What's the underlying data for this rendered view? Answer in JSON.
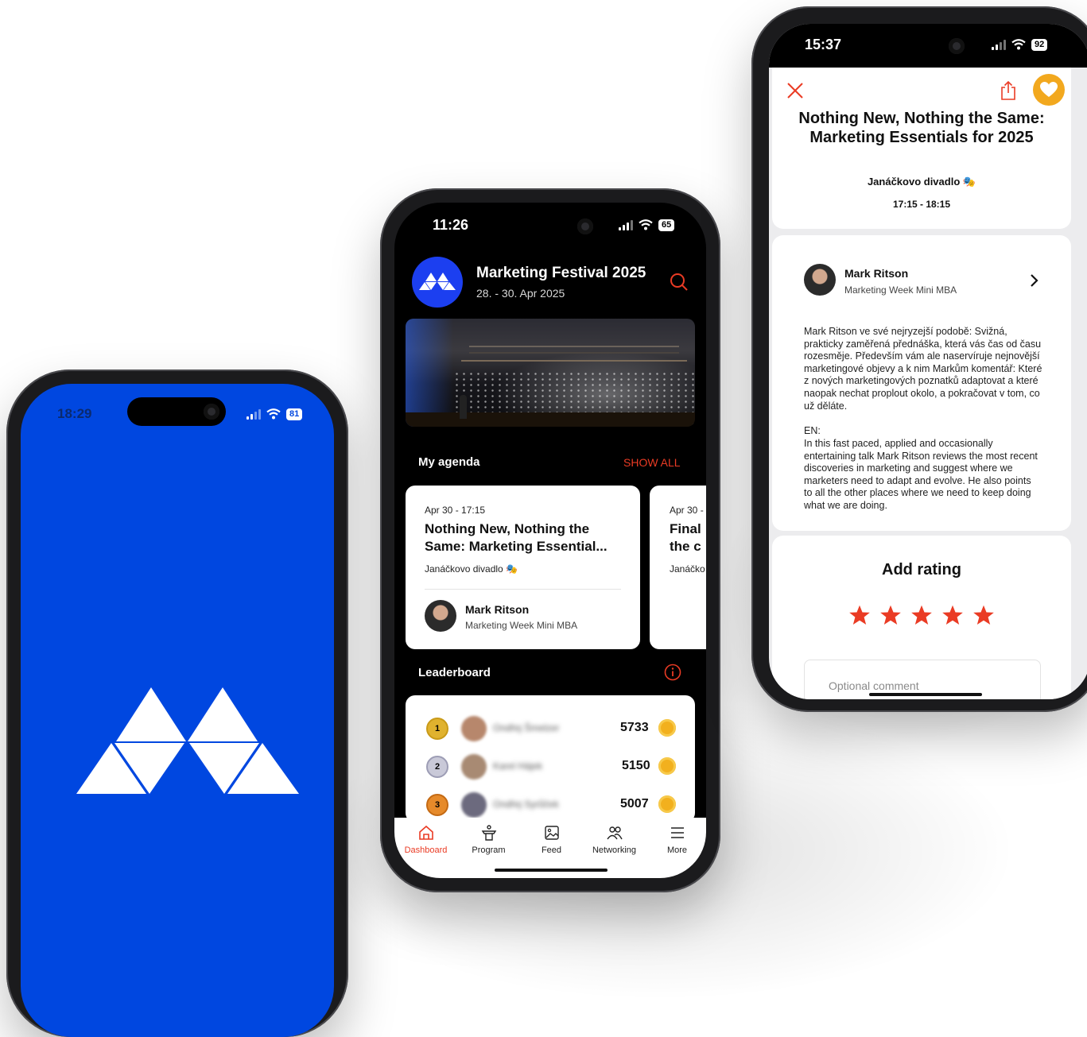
{
  "colors": {
    "brand_blue": "#0047e0",
    "accent_red": "#ea3b24",
    "gold": "#f2b01e"
  },
  "phone_splash": {
    "status": {
      "time": "18:29",
      "battery": "81"
    },
    "logo_icon": "triangles-logo-icon"
  },
  "phone_dashboard": {
    "status": {
      "time": "11:26",
      "battery": "65"
    },
    "event": {
      "title": "Marketing Festival 2025",
      "dates": "28. - 30. Apr 2025"
    },
    "agenda": {
      "section_title": "My agenda",
      "show_all": "SHOW ALL",
      "items": [
        {
          "time": "Apr 30 - 17:15",
          "title": "Nothing New, Nothing the Same: Marketing Essential...",
          "venue": "Janáčkovo divadlo 🎭",
          "speaker_name": "Mark Ritson",
          "speaker_org": "Marketing Week Mini MBA"
        },
        {
          "time": "Apr 30 -",
          "title": "Final the c",
          "venue": "Janáčko"
        }
      ]
    },
    "leaderboard": {
      "title": "Leaderboard",
      "rows": [
        {
          "rank": "1",
          "name": "Ondřej Šmelzer",
          "score": "5733"
        },
        {
          "rank": "2",
          "name": "Karel Hájek",
          "score": "5150"
        },
        {
          "rank": "3",
          "name": "Ondřej Syrůček",
          "score": "5007"
        }
      ]
    },
    "nav": [
      {
        "label": "Dashboard",
        "icon": "home-icon"
      },
      {
        "label": "Program",
        "icon": "podium-icon"
      },
      {
        "label": "Feed",
        "icon": "image-icon"
      },
      {
        "label": "Networking",
        "icon": "people-icon"
      },
      {
        "label": "More",
        "icon": "menu-icon"
      }
    ]
  },
  "phone_detail": {
    "status": {
      "time": "15:37",
      "battery": "92"
    },
    "session": {
      "title": "Nothing New, Nothing the Same: Marketing Essentials for 2025",
      "venue": "Janáčkovo divadlo 🎭",
      "time": "17:15 - 18:15"
    },
    "speaker": {
      "name": "Mark Ritson",
      "org": "Marketing Week Mini MBA"
    },
    "description_cz": "Mark Ritson ve své nejryzejší podobě: Svižná, prakticky zaměřená přednáška, která vás čas od času rozesměje. Především vám ale naservíruje nejnovější marketingové objevy a k nim Markům komentář: Které z nových marketingových poznatků adaptovat a které naopak nechat proplout okolo, a pokračovat v tom, co už děláte.",
    "en_label": "EN:",
    "description_en": "In this fast paced, applied and occasionally entertaining talk Mark Ritson reviews the most recent discoveries in marketing and suggest where we marketers need to adapt and evolve. He also points to all the other places where we need to keep doing what we are doing.",
    "rating": {
      "title": "Add rating",
      "stars": 5,
      "comment_placeholder": "Optional comment"
    }
  }
}
